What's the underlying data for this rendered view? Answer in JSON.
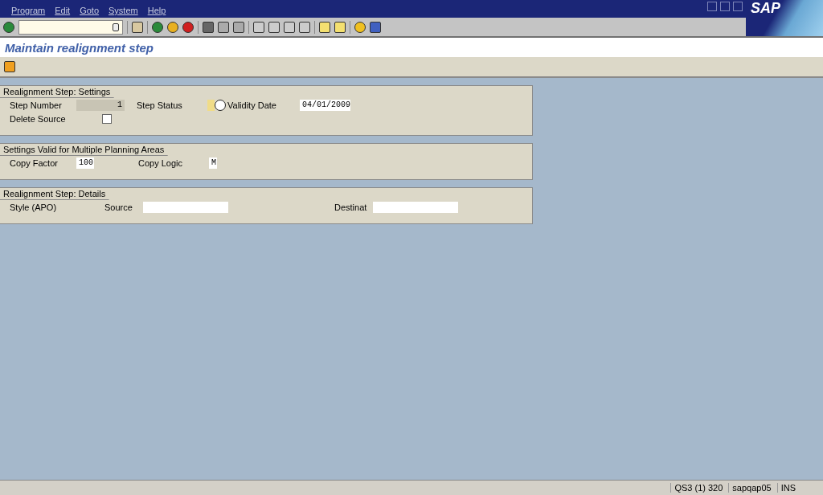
{
  "menu": [
    "Program",
    "Edit",
    "Goto",
    "System",
    "Help"
  ],
  "logo": "SAP",
  "title": "Maintain realignment step",
  "sections": [
    {
      "title": "Realignment Step: Settings",
      "rows": [
        [
          {
            "kind": "readonly",
            "label": "Step Number",
            "value": "1"
          },
          {
            "kind": "status",
            "label": "Step Status"
          },
          {
            "kind": "input",
            "label": "Validity Date",
            "value": "04/01/2009"
          }
        ],
        [
          {
            "kind": "checkbox",
            "label": "Delete Source",
            "checked": false
          }
        ]
      ]
    },
    {
      "title": "Settings Valid for Multiple Planning Areas",
      "rows": [
        [
          {
            "kind": "input",
            "label": "Copy Factor",
            "value": "100"
          },
          {
            "kind": "input",
            "label": "Copy Logic",
            "value": "M"
          }
        ]
      ]
    },
    {
      "title": "Realignment Step: Details",
      "rows": [
        [
          {
            "kind": "text",
            "label": "Style (APO)"
          },
          {
            "kind": "input",
            "label": "Source"
          },
          {
            "kind": "input",
            "label": "Destinat"
          }
        ]
      ]
    }
  ],
  "status_bar": {
    "system": "QS3 (1) 320",
    "server": "sapqap05",
    "mode": "INS"
  }
}
